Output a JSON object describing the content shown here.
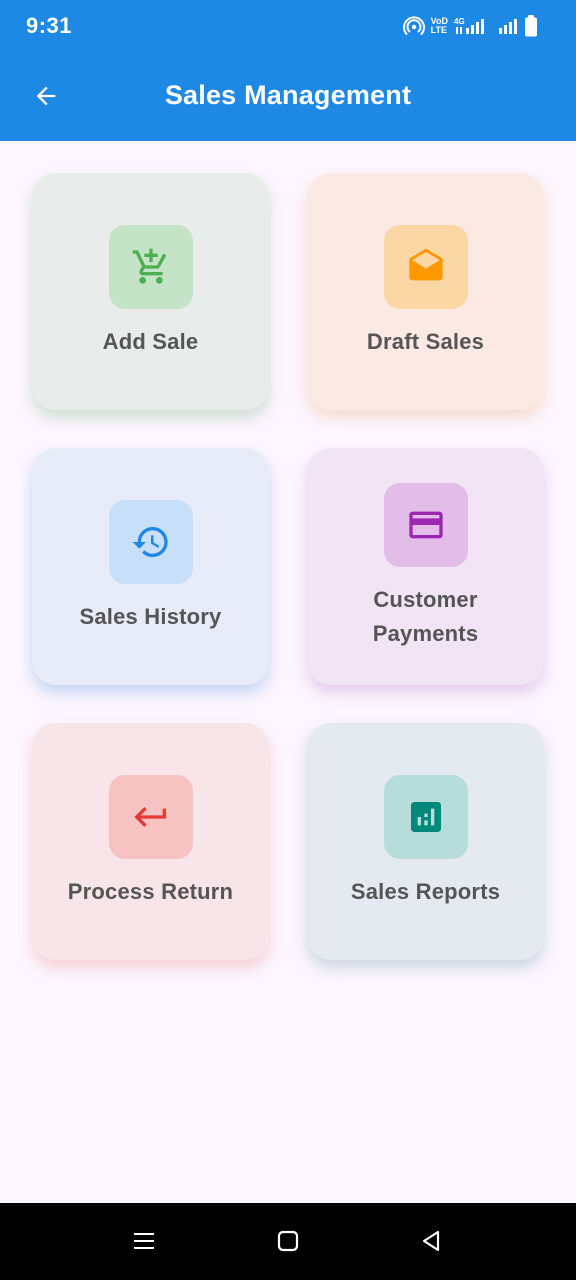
{
  "status": {
    "time": "9:31",
    "volte_top": "VoD",
    "volte_bottom": "LTE",
    "network": "4G"
  },
  "appbar": {
    "title": "Sales Management",
    "back_icon": "arrow-left-icon"
  },
  "cards": [
    {
      "label": "Add Sale",
      "icon": "cart-add-icon",
      "color": "#4caf50"
    },
    {
      "label": "Draft Sales",
      "icon": "envelope-open-icon",
      "color": "#ff9800"
    },
    {
      "label": "Sales History",
      "icon": "history-icon",
      "color": "#1e88e5"
    },
    {
      "label": "Customer\nPayments",
      "icon": "credit-card-icon",
      "color": "#9c27b0"
    },
    {
      "label": "Process Return",
      "icon": "return-arrow-icon",
      "color": "#e53935"
    },
    {
      "label": "Sales Reports",
      "icon": "bar-chart-icon",
      "color": "#00897b"
    }
  ],
  "colors": {
    "primary": "#1e88e5",
    "background": "#fcf6fe",
    "label_text": "#555555"
  },
  "navbar": {
    "buttons": [
      "menu-icon",
      "home-icon",
      "back-triangle-icon"
    ]
  }
}
